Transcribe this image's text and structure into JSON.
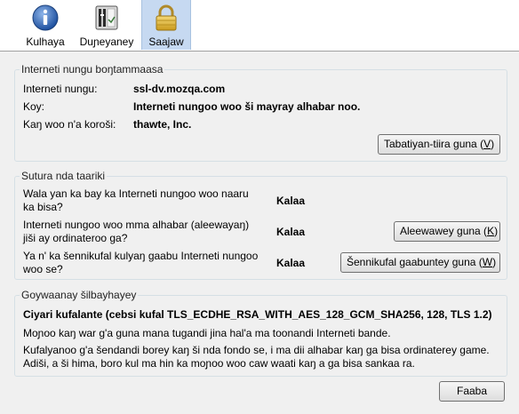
{
  "tabs": [
    {
      "label": "Kulhaya",
      "icon": "info-icon"
    },
    {
      "label": "Duɲeyaney",
      "icon": "media-icon"
    },
    {
      "label": "Saajaw",
      "icon": "lock-icon"
    }
  ],
  "identity": {
    "title": "Interneti nungu boŋtammaasa",
    "site_label": "Interneti nungu:",
    "site_value": "ssl-dv.mozqa.com",
    "owner_label": "Koy:",
    "owner_value": "Interneti nungoo woo ši mayray alhabar noo.",
    "verifier_label": "Kaŋ woo n'a koroši:",
    "verifier_value": "thawte, Inc.",
    "view_cert_button": "Tabatiyan-tiira guna (",
    "view_cert_key": "V",
    "view_cert_suffix": ")"
  },
  "privacy": {
    "title": "Sutura nda taariki",
    "q1_line1": "Wala yan ka bay ka Interneti nungoo woo naaru",
    "q1_line2": "ka bisa?",
    "q1_answer": "Kalaa",
    "q2_line1": "Interneti nungoo woo mma alhabar (aleewayaŋ)",
    "q2_line2": "jiši ay ordinateroo ga?",
    "q2_answer": "Kalaa",
    "cookies_button": "Aleewawey guna (",
    "cookies_key": "K",
    "cookies_suffix": ")",
    "q3_line1": "Ya n' ka šennikufal kulyaŋ gaabu Interneti nungoo",
    "q3_line2": "woo se?",
    "q3_answer": "Kalaa",
    "passwords_button": "Šennikufal gaabuntey guna (",
    "passwords_key": "W",
    "passwords_suffix": ")"
  },
  "technical": {
    "title": "Goywaanay šilbayhayey",
    "cipher": "Ciyari kufalante (cebsi kufal TLS_ECDHE_RSA_WITH_AES_128_GCM_SHA256, 128, TLS 1.2)",
    "line1": "Moɲoo kaŋ war g'a guna mana tugandi jina hal'a ma toonandi Interneti bande.",
    "line2": "Kufalyanoo g'a šendandi borey kaŋ ši nda fondo se, i ma dii alhabar kaŋ ga bisa ordinaterey game.",
    "line3": "Adiši, a ši hima, boro kul ma hin ka moɲoo woo caw waati kaŋ a ga bisa sankaa ra."
  },
  "help_button": "Faaba"
}
